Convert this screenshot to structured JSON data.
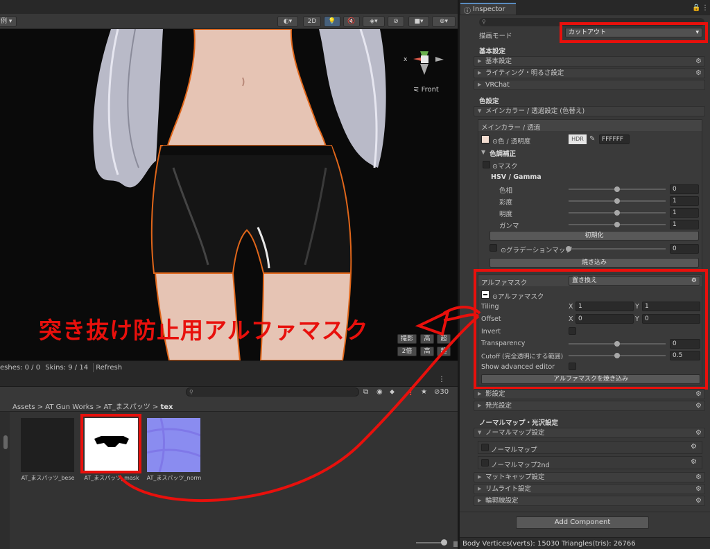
{
  "scene": {
    "toolbar": {
      "left_dropdown": "例",
      "mode_2d": "2D"
    },
    "gizmo": {
      "axis_x": "x",
      "view_label": "Front"
    },
    "overlay_text": "突き抜け防止用アルファマスク",
    "right_buttons": {
      "capture": "撮影",
      "high1": "高",
      "super1": "超",
      "double": "2倍",
      "high2": "高",
      "super2": "超"
    },
    "status": {
      "meshes": "eshes: 0 / 0",
      "skins": "Skins: 9 / 14",
      "refresh": "Refresh"
    }
  },
  "project": {
    "hidden_count": "30",
    "breadcrumb": [
      "Assets",
      "AT Gun Works",
      "AT_まスパッツ",
      "tex"
    ],
    "assets": [
      {
        "label": "AT_まスパッツ_bese"
      },
      {
        "label": "AT_まスパッツ_mask"
      },
      {
        "label": "AT_まスパッツ_norm"
      }
    ]
  },
  "inspector": {
    "tab_label": "Inspector",
    "render_mode_label": "描画モード",
    "render_mode_value": "カットアウト",
    "basic_section": "基本設定",
    "basic_foldouts": [
      "基本設定",
      "ライティング・明るさ設定",
      "VRChat"
    ],
    "color_section": "色設定",
    "main_color_foldout": "メインカラー / 透過設定 (色替え)",
    "main_color_box": {
      "title": "メインカラー / 透過",
      "color_label": "⊙色 / 透明度",
      "hdr": "HDR",
      "hex": "FFFFFF",
      "color_correction": "色調補正",
      "mask_label": "⊙マスク",
      "hsv_title": "HSV / Gamma",
      "hsv": [
        {
          "label": "色相",
          "value": "0",
          "fraction": 0.5
        },
        {
          "label": "彩度",
          "value": "1",
          "fraction": 0.5
        },
        {
          "label": "明度",
          "value": "1",
          "fraction": 0.5
        },
        {
          "label": "ガンマ",
          "value": "1",
          "fraction": 0.5
        }
      ],
      "reset": "初期化",
      "gradation_label": "⊙グラデーションマップ",
      "gradation_value": "0",
      "gradation_fraction": 0.0,
      "bake": "焼き込み"
    },
    "alpha_mask": {
      "title": "アルファマスク",
      "mode": "置き換え",
      "texture_label": "⊙アルファマスク",
      "tiling_label": "Tiling",
      "tiling_x": "1",
      "tiling_y": "1",
      "offset_label": "Offset",
      "offset_x": "0",
      "offset_y": "0",
      "axis_x": "X",
      "axis_y": "Y",
      "invert_label": "Invert",
      "transparency_label": "Transparency",
      "transparency_value": "0",
      "transparency_fraction": 0.5,
      "cutoff_label": "Cutoff (完全透明にする範囲)",
      "cutoff_value": "0.5",
      "cutoff_fraction": 0.5,
      "advanced_label": "Show advanced editor",
      "bake_button": "アルファマスクを焼き込み"
    },
    "after_foldouts": [
      "影設定",
      "発光設定"
    ],
    "normal_section": "ノーマルマップ・光沢設定",
    "normal_foldout": "ノーマルマップ設定",
    "normal_items": [
      "ノーマルマップ",
      "ノーマルマップ2nd"
    ],
    "bottom_foldouts": [
      "マットキャップ設定",
      "リムライト設定",
      "輪郭線設定"
    ],
    "add_component": "Add Component",
    "footer": "Body Vertices(verts): 15030  Triangles(tris): 26766"
  },
  "colors": {
    "highlight_red": "#e8100c",
    "panel": "#383838",
    "outline_orange": "#e0661a"
  }
}
